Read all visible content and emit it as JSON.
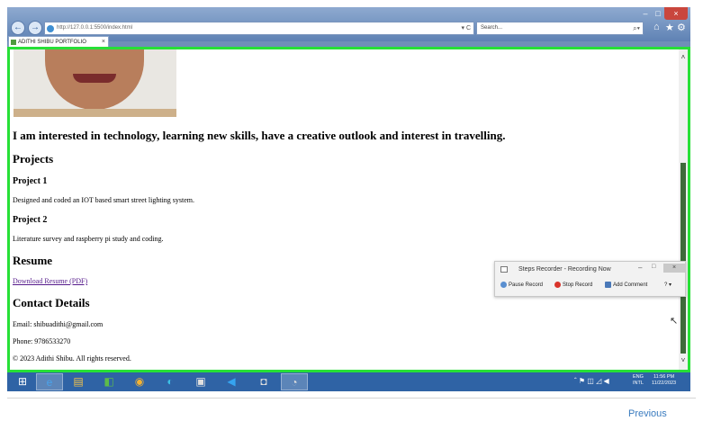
{
  "browser": {
    "address": "http://127.0.0.1:5500/index.html",
    "address_controls": "▾ C",
    "search_placeholder": "Search...",
    "search_controls": "⌕▾",
    "tab_title": "ADITHI SHIBU PORTFOLIO",
    "tab_close": "×",
    "window_buttons": [
      "–",
      "□",
      "×"
    ],
    "nav_back": "←",
    "nav_forward": "→",
    "toolbar_icons": [
      "home-icon",
      "star-icon",
      "gear-icon"
    ]
  },
  "page": {
    "intro": "I am interested in technology, learning new skills, have a creative outlook and interest in travelling.",
    "projects_heading": "Projects",
    "projects": [
      {
        "title": "Project 1",
        "description": "Designed and coded an IOT based smart street lighting system."
      },
      {
        "title": "Project 2",
        "description": "Literature survey and raspberry pi study and coding."
      }
    ],
    "resume_heading": "Resume",
    "resume_link": "Download Resume (PDF)",
    "contact_heading": "Contact Details",
    "email": "Email: shibuadithi@gmail.com",
    "phone": "Phone: 9786533270",
    "copyright": "© 2023 Adithi Shibu. All rights reserved."
  },
  "steps_recorder": {
    "title": "Steps Recorder - Recording Now",
    "pause": "Pause Record",
    "stop": "Stop Record",
    "comment": "Add Comment",
    "help": "? ▾"
  },
  "taskbar": {
    "apps": [
      "windows-start-icon",
      "internet-explorer-icon",
      "file-explorer-icon",
      "store-icon",
      "chrome-icon",
      "edge-icon",
      "app-icon",
      "vscode-icon",
      "camera-icon",
      "steps-recorder-icon"
    ],
    "tray": "ˆ ⚑ ◫ ◿ ◀",
    "lang_line1": "ENG",
    "lang_line2": "INTL",
    "time": "11:56 PM",
    "date": "11/22/2023"
  },
  "footer": {
    "previous": "Previous"
  },
  "colors": {
    "highlight_border": "#27e037",
    "taskbar": "#2f63a5",
    "link_visited": "#551a8b"
  }
}
